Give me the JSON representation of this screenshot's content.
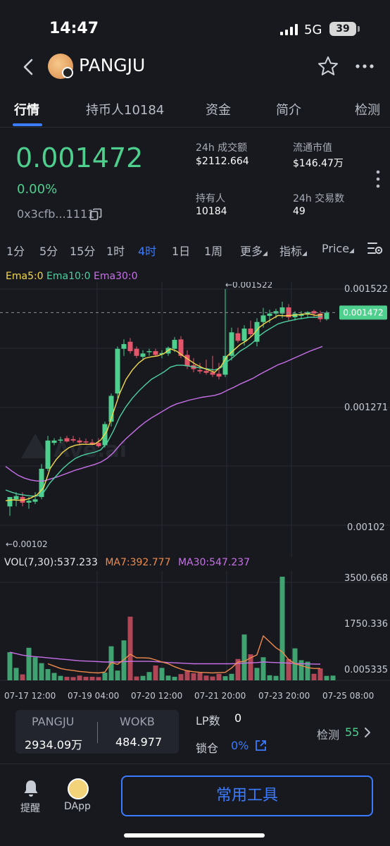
{
  "status_bar": {
    "time": "14:47",
    "network": "5G",
    "battery": "39"
  },
  "header": {
    "title": "PANGJU"
  },
  "tabs": [
    {
      "label": "行情",
      "active": true
    },
    {
      "label": "持币人10184"
    },
    {
      "label": "资金"
    },
    {
      "label": "简介"
    },
    {
      "label": "检测"
    }
  ],
  "price": {
    "value": "0.001472",
    "change": "0.00%",
    "address": "0x3cfb...1111"
  },
  "stats": [
    {
      "label": "24h 成交额",
      "value": "$2112.664"
    },
    {
      "label": "流通市值",
      "value": "$146.47万"
    },
    {
      "label": "持有人",
      "value": "10184"
    },
    {
      "label": "24h 交易数",
      "value": "49"
    }
  ],
  "intervals": [
    "1分",
    "5分",
    "15分",
    "1时",
    "4时",
    "1日",
    "1周"
  ],
  "active_interval": "4时",
  "menus": {
    "more": "更多",
    "indicator": "指标",
    "price": "Price"
  },
  "ema_legend": {
    "ema5": "Ema5:0",
    "ema10": "Ema10:0",
    "ema30": "Ema30:0"
  },
  "vol_legend": {
    "vol": "VOL(7,30):537.233",
    "ma7": "MA7:392.777",
    "ma30": "MA30:547.237"
  },
  "colors": {
    "up": "#4fcf8e",
    "down": "#e5566b",
    "ema5": "#f3d94e",
    "ema10": "#4fd0a0",
    "ema30": "#c870e8",
    "accent": "#3b7bff"
  },
  "chart_data": {
    "type": "candlestick",
    "price_axis": {
      "ticks": [
        "0.001522",
        "0.001271",
        "0.00102"
      ],
      "ylim": [
        0.00102,
        0.001522
      ]
    },
    "current_price_label": "0.001472",
    "high_annotation": "←0.001522",
    "low_annotation": "←0.00102",
    "watermark": "Ave.ai",
    "x_ticks": [
      "07-17 12:00",
      "07-19 04:00",
      "07-20 12:00",
      "07-21 20:00",
      "07-23 20:00",
      "07-25 08:00"
    ],
    "candles": [
      {
        "o": 0.00106,
        "h": 0.00108,
        "l": 0.00104,
        "c": 0.00108
      },
      {
        "o": 0.001075,
        "h": 0.00109,
        "l": 0.00106,
        "c": 0.001082
      },
      {
        "o": 0.00108,
        "h": 0.00109,
        "l": 0.00106,
        "c": 0.001068
      },
      {
        "o": 0.001068,
        "h": 0.00108,
        "l": 0.001055,
        "c": 0.001072
      },
      {
        "o": 0.00107,
        "h": 0.00109,
        "l": 0.001065,
        "c": 0.001075
      },
      {
        "o": 0.00108,
        "h": 0.00115,
        "l": 0.001075,
        "c": 0.00114
      },
      {
        "o": 0.00114,
        "h": 0.00121,
        "l": 0.001135,
        "c": 0.0012
      },
      {
        "o": 0.001195,
        "h": 0.001205,
        "l": 0.00119,
        "c": 0.0012
      },
      {
        "o": 0.0012,
        "h": 0.001208,
        "l": 0.001195,
        "c": 0.001202
      },
      {
        "o": 0.001205,
        "h": 0.00121,
        "l": 0.001196,
        "c": 0.001198
      },
      {
        "o": 0.001203,
        "h": 0.00121,
        "l": 0.001196,
        "c": 0.0012
      },
      {
        "o": 0.0012,
        "h": 0.001206,
        "l": 0.001192,
        "c": 0.001196
      },
      {
        "o": 0.001198,
        "h": 0.001204,
        "l": 0.001193,
        "c": 0.001197
      },
      {
        "o": 0.001196,
        "h": 0.001203,
        "l": 0.00119,
        "c": 0.001192
      },
      {
        "o": 0.001195,
        "h": 0.001205,
        "l": 0.001185,
        "c": 0.001188
      },
      {
        "o": 0.00119,
        "h": 0.00124,
        "l": 0.001185,
        "c": 0.001235
      },
      {
        "o": 0.00124,
        "h": 0.0013,
        "l": 0.00123,
        "c": 0.001295
      },
      {
        "o": 0.0013,
        "h": 0.0014,
        "l": 0.00129,
        "c": 0.001395
      },
      {
        "o": 0.001395,
        "h": 0.001415,
        "l": 0.00138,
        "c": 0.001405
      },
      {
        "o": 0.00141,
        "h": 0.001418,
        "l": 0.001385,
        "c": 0.00139
      },
      {
        "o": 0.001395,
        "h": 0.0014,
        "l": 0.001375,
        "c": 0.00138
      },
      {
        "o": 0.001378,
        "h": 0.001392,
        "l": 0.001372,
        "c": 0.001385
      },
      {
        "o": 0.001388,
        "h": 0.001395,
        "l": 0.00138,
        "c": 0.00139
      },
      {
        "o": 0.00139,
        "h": 0.001395,
        "l": 0.001378,
        "c": 0.001382
      },
      {
        "o": 0.001383,
        "h": 0.001392,
        "l": 0.001375,
        "c": 0.001386
      },
      {
        "o": 0.001385,
        "h": 0.0014,
        "l": 0.00138,
        "c": 0.001397
      },
      {
        "o": 0.001395,
        "h": 0.00142,
        "l": 0.001388,
        "c": 0.001414
      },
      {
        "o": 0.001415,
        "h": 0.001422,
        "l": 0.001375,
        "c": 0.00138
      },
      {
        "o": 0.001382,
        "h": 0.001392,
        "l": 0.001352,
        "c": 0.001358
      },
      {
        "o": 0.00136,
        "h": 0.001375,
        "l": 0.001345,
        "c": 0.001352
      },
      {
        "o": 0.00135,
        "h": 0.001365,
        "l": 0.001342,
        "c": 0.001347
      },
      {
        "o": 0.001348,
        "h": 0.001372,
        "l": 0.00134,
        "c": 0.001344
      },
      {
        "o": 0.001345,
        "h": 0.00138,
        "l": 0.001335,
        "c": 0.00134
      },
      {
        "o": 0.001342,
        "h": 0.001365,
        "l": 0.00133,
        "c": 0.001336
      },
      {
        "o": 0.00134,
        "h": 0.001522,
        "l": 0.001335,
        "c": 0.00138
      },
      {
        "o": 0.00138,
        "h": 0.00144,
        "l": 0.00137,
        "c": 0.00143
      },
      {
        "o": 0.001428,
        "h": 0.00144,
        "l": 0.001408,
        "c": 0.001412
      },
      {
        "o": 0.001412,
        "h": 0.001445,
        "l": 0.001402,
        "c": 0.001438
      },
      {
        "o": 0.001438,
        "h": 0.001455,
        "l": 0.00142,
        "c": 0.001426
      },
      {
        "o": 0.00141,
        "h": 0.00146,
        "l": 0.0014,
        "c": 0.001452
      },
      {
        "o": 0.001452,
        "h": 0.001482,
        "l": 0.00144,
        "c": 0.001466
      },
      {
        "o": 0.001465,
        "h": 0.001478,
        "l": 0.00145,
        "c": 0.00147
      },
      {
        "o": 0.00147,
        "h": 0.00148,
        "l": 0.00146,
        "c": 0.001475
      },
      {
        "o": 0.00147,
        "h": 0.001495,
        "l": 0.00146,
        "c": 0.001483
      },
      {
        "o": 0.001483,
        "h": 0.00149,
        "l": 0.001455,
        "c": 0.001462
      },
      {
        "o": 0.001462,
        "h": 0.001475,
        "l": 0.001455,
        "c": 0.00147
      },
      {
        "o": 0.001465,
        "h": 0.001475,
        "l": 0.001458,
        "c": 0.001468
      },
      {
        "o": 0.001468,
        "h": 0.001475,
        "l": 0.001462,
        "c": 0.001473
      },
      {
        "o": 0.001475,
        "h": 0.001478,
        "l": 0.001462,
        "c": 0.00147
      },
      {
        "o": 0.00147,
        "h": 0.001476,
        "l": 0.001452,
        "c": 0.001458
      },
      {
        "o": 0.001458,
        "h": 0.001476,
        "l": 0.001455,
        "c": 0.001472
      }
    ],
    "ema5": [
      0.001072,
      0.001074,
      0.001073,
      0.001074,
      0.001078,
      0.001085,
      0.0011,
      0.00114,
      0.00116,
      0.001175,
      0.001185,
      0.00119,
      0.001192,
      0.001192,
      0.001192,
      0.001201,
      0.00122,
      0.00126,
      0.0013,
      0.00133,
      0.00135,
      0.001365,
      0.001375,
      0.001378,
      0.00138,
      0.001385,
      0.001395,
      0.00139,
      0.00138,
      0.001371,
      0.001362,
      0.001355,
      0.00135,
      0.001345,
      0.001358,
      0.00138,
      0.001392,
      0.001404,
      0.001412,
      0.001424,
      0.00144,
      0.00145,
      0.001458,
      0.001466,
      0.001465,
      0.001466,
      0.001467,
      0.001469,
      0.001469,
      0.001466,
      0.001468
    ],
    "ema10": [
      0.001095,
      0.00109,
      0.001086,
      0.001084,
      0.001082,
      0.001082,
      0.00109,
      0.00111,
      0.001125,
      0.00114,
      0.001152,
      0.001162,
      0.001168,
      0.001172,
      0.001175,
      0.00118,
      0.001195,
      0.00122,
      0.00125,
      0.001272,
      0.00129,
      0.001305,
      0.001318,
      0.00133,
      0.001338,
      0.001346,
      0.001356,
      0.00136,
      0.00136,
      0.001358,
      0.001356,
      0.001354,
      0.001352,
      0.00135,
      0.001355,
      0.001368,
      0.001378,
      0.00139,
      0.001398,
      0.001408,
      0.001422,
      0.001432,
      0.00144,
      0.001448,
      0.001452,
      0.001455,
      0.001458,
      0.00146,
      0.001462,
      0.001462,
      0.001464
    ],
    "ema30": [
      0.001145,
      0.001135,
      0.001126,
      0.00112,
      0.001116,
      0.001114,
      0.001114,
      0.001118,
      0.001122,
      0.001127,
      0.001132,
      0.001137,
      0.001141,
      0.001145,
      0.001149,
      0.001154,
      0.001162,
      0.001174,
      0.00119,
      0.001204,
      0.001216,
      0.001228,
      0.001239,
      0.001248,
      0.001256,
      0.001264,
      0.001272,
      0.001278,
      0.001282,
      0.001286,
      0.001289,
      0.001292,
      0.001294,
      0.001296,
      0.0013,
      0.001307,
      0.001313,
      0.00132,
      0.001326,
      0.001332,
      0.00134,
      0.001347,
      0.001354,
      0.001361,
      0.001366,
      0.001372,
      0.001378,
      0.001384,
      0.00139,
      0.001395,
      0.0014
    ],
    "volume_axis": {
      "ticks": [
        "3500.668",
        "1750.336",
        "0.005335"
      ],
      "ylim": [
        0,
        3500.668
      ]
    },
    "volume": [
      950,
      420,
      200,
      1100,
      780,
      580,
      380,
      250,
      150,
      120,
      110,
      160,
      120,
      120,
      110,
      260,
      1150,
      330,
      1350,
      2150,
      130,
      150,
      280,
      500,
      420,
      160,
      120,
      210,
      340,
      240,
      250,
      160,
      130,
      220,
      140,
      220,
      720,
      1550,
      880,
      420,
      780,
      170,
      150,
      3500,
      720,
      1080,
      680,
      630,
      220,
      400,
      150,
      160
    ],
    "ma7": [
      null,
      null,
      null,
      null,
      null,
      null,
      560,
      480,
      400,
      360,
      330,
      300,
      280,
      260,
      250,
      280,
      600,
      540,
      700,
      880,
      760,
      760,
      750,
      690,
      620,
      560,
      460,
      380,
      320,
      290,
      270,
      260,
      250,
      260,
      270,
      420,
      620,
      640,
      760,
      860,
      1500,
      1300,
      1100,
      960,
      700,
      560,
      500,
      430,
      400,
      400
    ],
    "ma30": [
      950,
      900,
      850,
      820,
      800,
      780,
      760,
      740,
      720,
      700,
      680,
      660,
      650,
      640,
      630,
      620,
      620,
      620,
      630,
      640,
      640,
      640,
      640,
      630,
      620,
      600,
      590,
      580,
      570,
      560,
      560,
      560,
      560,
      560,
      560,
      560,
      570,
      580,
      590,
      600,
      620,
      610,
      600,
      590,
      580,
      570,
      560,
      555,
      550,
      547
    ]
  },
  "bottom_panel": {
    "pair": {
      "base_label": "PANGJU",
      "quote_label": "WOKB",
      "base_value": "2934.09万",
      "quote_value": "484.977"
    },
    "lp_label": "LP数",
    "lp_value": "0",
    "lock_label": "锁仓",
    "lock_value": "0%",
    "detect_label": "检测",
    "detect_value": "55"
  },
  "nav": {
    "reminder": "提醒",
    "dapp": "DApp",
    "tools_button": "常用工具"
  }
}
